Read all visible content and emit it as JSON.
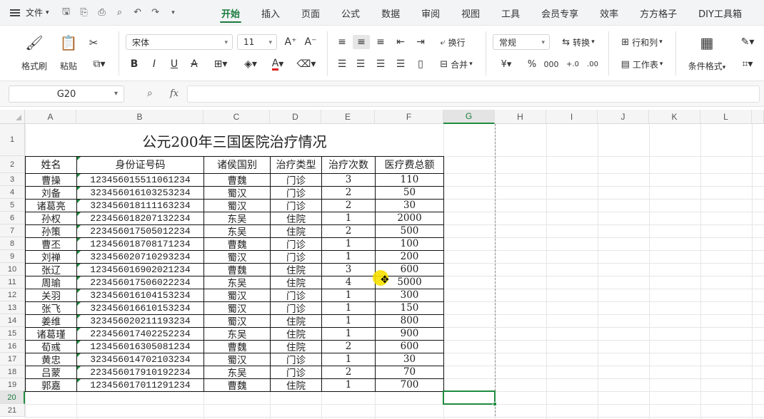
{
  "menubar": {
    "file_label": "文件",
    "tabs": [
      "开始",
      "插入",
      "页面",
      "公式",
      "数据",
      "审阅",
      "视图",
      "工具",
      "会员专享",
      "效率",
      "方方格子",
      "DIY工具箱"
    ],
    "active_tab": "开始"
  },
  "ribbon": {
    "format_painter": "格式刷",
    "paste": "粘贴",
    "font_name": "宋体",
    "font_size": "11",
    "wrap_text": "换行",
    "merge": "合并",
    "number_format": "常规",
    "convert": "转换",
    "row_col": "行和列",
    "worksheet": "工作表",
    "cond_format": "条件格式"
  },
  "formula_bar": {
    "cell_ref": "G20",
    "fx": "fx",
    "content": ""
  },
  "column_headers": [
    "A",
    "B",
    "C",
    "D",
    "E",
    "F",
    "G",
    "H",
    "I",
    "J",
    "K",
    "L"
  ],
  "selected_column": "G",
  "row_numbers": [
    "1",
    "2",
    "3",
    "4",
    "5",
    "6",
    "7",
    "8",
    "9",
    "10",
    "11",
    "12",
    "13",
    "14",
    "15",
    "16",
    "17",
    "18",
    "19",
    "20",
    "21"
  ],
  "selected_row": "20",
  "sheet": {
    "title": "公元200年三国医院治疗情况",
    "headers": [
      "姓名",
      "身份证号码",
      "诸侯国别",
      "治疗类型",
      "治疗次数",
      "医疗费总额"
    ],
    "rows": [
      [
        "曹操",
        "123456015511061234",
        "曹魏",
        "门诊",
        "3",
        "110"
      ],
      [
        "刘备",
        "323456016103253234",
        "蜀汉",
        "门诊",
        "2",
        "50"
      ],
      [
        "诸葛亮",
        "323456018111163234",
        "蜀汉",
        "门诊",
        "2",
        "30"
      ],
      [
        "孙权",
        "223456018207132234",
        "东吴",
        "住院",
        "1",
        "2000"
      ],
      [
        "孙策",
        "223456017505012234",
        "东吴",
        "住院",
        "2",
        "500"
      ],
      [
        "曹丕",
        "123456018708171234",
        "曹魏",
        "门诊",
        "1",
        "100"
      ],
      [
        "刘禅",
        "323456020710293234",
        "蜀汉",
        "门诊",
        "1",
        "200"
      ],
      [
        "张辽",
        "123456016902021234",
        "曹魏",
        "住院",
        "3",
        "600"
      ],
      [
        "周瑜",
        "223456017506022234",
        "东吴",
        "住院",
        "4",
        "5000"
      ],
      [
        "关羽",
        "323456016104153234",
        "蜀汉",
        "门诊",
        "1",
        "300"
      ],
      [
        "张飞",
        "323456016610153234",
        "蜀汉",
        "门诊",
        "1",
        "150"
      ],
      [
        "姜维",
        "323456020211193234",
        "蜀汉",
        "住院",
        "1",
        "800"
      ],
      [
        "诸葛瑾",
        "223456017402252234",
        "东吴",
        "住院",
        "1",
        "900"
      ],
      [
        "荀彧",
        "123456016305081234",
        "曹魏",
        "住院",
        "2",
        "600"
      ],
      [
        "黄忠",
        "323456014702103234",
        "蜀汉",
        "门诊",
        "1",
        "30"
      ],
      [
        "吕蒙",
        "223456017910192234",
        "东吴",
        "门诊",
        "2",
        "70"
      ],
      [
        "郭嘉",
        "123456017011291234",
        "曹魏",
        "住院",
        "1",
        "700"
      ]
    ]
  },
  "colors": {
    "accent": "#1b7a3e",
    "selection": "#1f8b3f",
    "cursor_highlight": "#f7e000"
  }
}
